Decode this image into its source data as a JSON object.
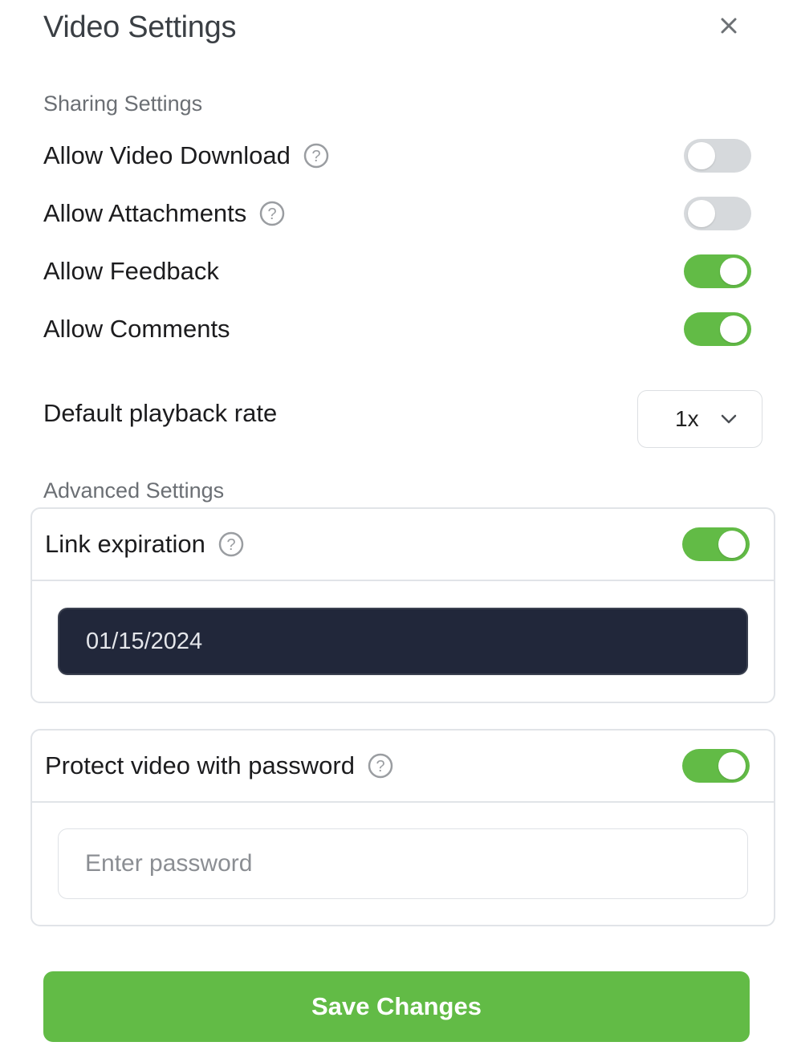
{
  "dialog": {
    "title": "Video Settings"
  },
  "sharing": {
    "section_label": "Sharing Settings",
    "items": [
      {
        "label": "Allow Video Download",
        "has_help": true,
        "enabled": false
      },
      {
        "label": "Allow Attachments",
        "has_help": true,
        "enabled": false
      },
      {
        "label": "Allow Feedback",
        "has_help": false,
        "enabled": true
      },
      {
        "label": "Allow Comments",
        "has_help": false,
        "enabled": true
      }
    ]
  },
  "playback": {
    "label": "Default playback rate",
    "selected": "1x"
  },
  "advanced": {
    "section_label": "Advanced Settings",
    "link_expiration": {
      "label": "Link expiration",
      "enabled": true,
      "date_value": "01/15/2024"
    },
    "password": {
      "label": "Protect video with password",
      "enabled": true,
      "placeholder": "Enter password"
    }
  },
  "actions": {
    "save_label": "Save Changes"
  },
  "colors": {
    "accent_green": "#62bb46",
    "toggle_off": "#d6d9dc",
    "date_field_bg": "#21273a"
  },
  "icons": {
    "close": "close-icon",
    "help": "question-circle-icon",
    "dropdown": "chevron-down-icon"
  }
}
